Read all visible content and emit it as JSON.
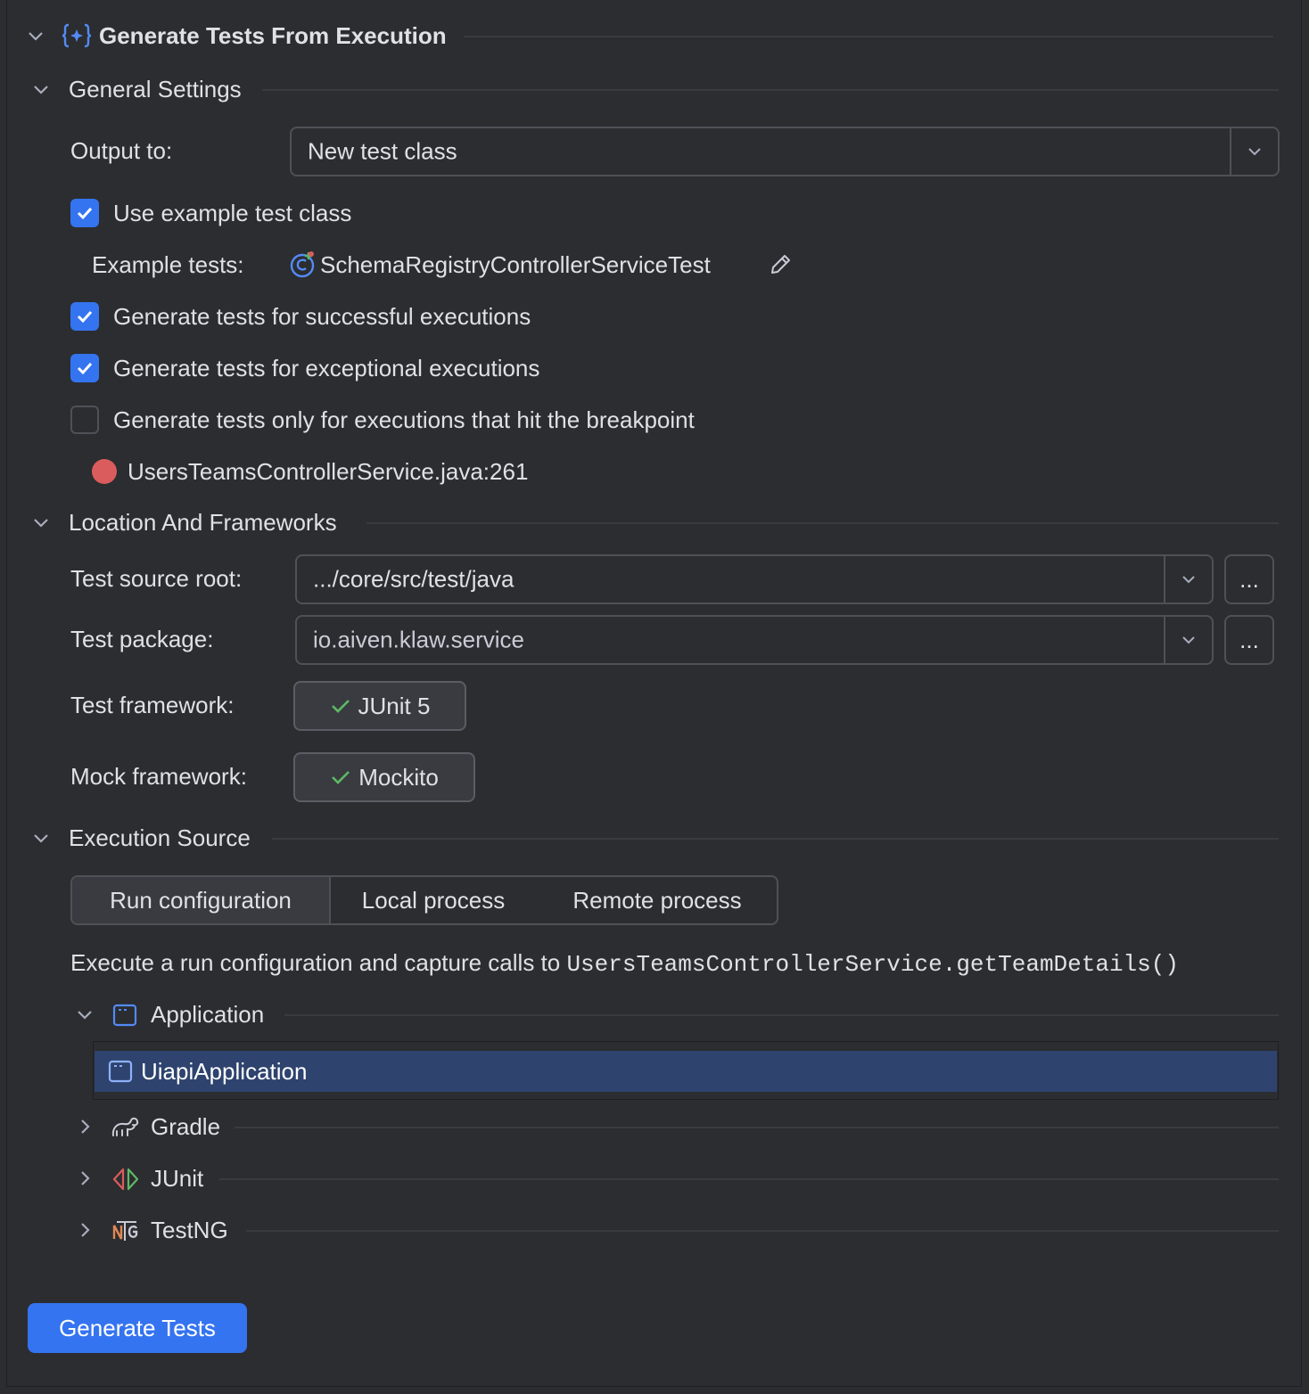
{
  "header": {
    "title": "Generate Tests From Execution",
    "icon": "ai-brackets-icon"
  },
  "general": {
    "title": "General Settings",
    "output_label": "Output to:",
    "output_value": "New test class",
    "use_example_label": "Use example test class",
    "use_example_checked": true,
    "example_tests_label": "Example tests:",
    "example_tests_value": "SchemaRegistryControllerServiceTest",
    "successful_label": "Generate tests for successful executions",
    "successful_checked": true,
    "exceptional_label": "Generate tests for exceptional executions",
    "exceptional_checked": true,
    "breakpoint_only_label": "Generate tests only for executions that hit the breakpoint",
    "breakpoint_only_checked": false,
    "breakpoint_location": "UsersTeamsControllerService.java:261"
  },
  "location": {
    "title": "Location And Frameworks",
    "source_root_label": "Test source root:",
    "source_root_value": ".../core/src/test/java",
    "package_label": "Test package:",
    "package_value": "io.aiven.klaw.service",
    "browse_label": "...",
    "framework_label": "Test framework:",
    "framework_value": "JUnit 5",
    "mock_label": "Mock framework:",
    "mock_value": "Mockito"
  },
  "execution": {
    "title": "Execution Source",
    "tabs": [
      "Run configuration",
      "Local process",
      "Remote process"
    ],
    "active_tab": "Run configuration",
    "description_prefix": "Execute a run configuration and capture calls to ",
    "description_code": "UsersTeamsControllerService.getTeamDetails()",
    "tree": {
      "application": "Application",
      "application_child": "UiapiApplication",
      "gradle": "Gradle",
      "junit": "JUnit",
      "testng": "TestNG"
    }
  },
  "footer": {
    "generate_label": "Generate Tests"
  },
  "colors": {
    "accent": "#3574f0",
    "selection": "#2e436e",
    "breakpoint": "#db5c5c",
    "check_green": "#5fb865"
  }
}
